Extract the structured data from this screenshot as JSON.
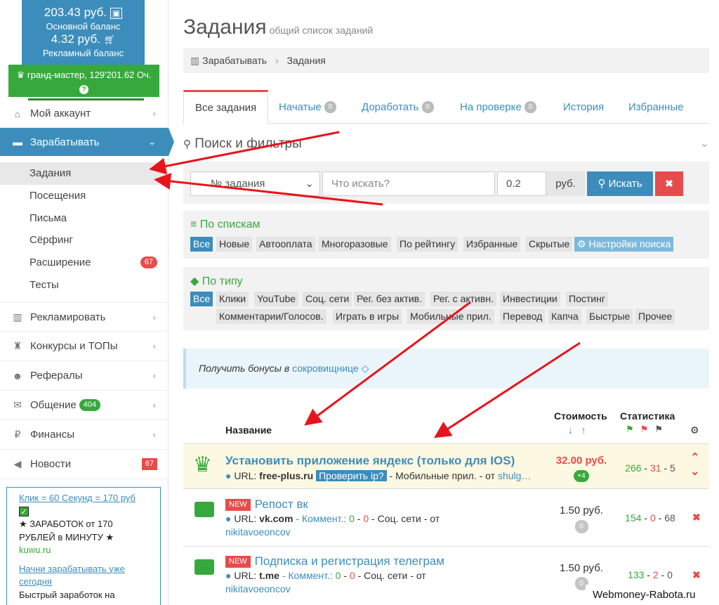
{
  "balance": {
    "main_amount": "203.43 руб.",
    "main_label": "Основной баланс",
    "ad_amount": "4.32 руб.",
    "ad_label": "Рекламный баланс"
  },
  "rank": {
    "text": "гранд-мастер, 129'201.62 Оч.",
    "help": "?"
  },
  "sidebar": {
    "my_account": "Мой аккаунт",
    "earn": "Зарабатывать",
    "sub_items": [
      "Задания",
      "Посещения",
      "Письма",
      "Сёрфинг",
      "Расширение",
      "Тесты"
    ],
    "ext_badge": "67",
    "advertise": "Рекламировать",
    "contests": "Конкурсы и ТОПы",
    "referrals": "Рефералы",
    "chat": "Общение",
    "chat_badge": "404",
    "finance": "Финансы",
    "news": "Новости",
    "news_badge": "67"
  },
  "ad": {
    "line1": "Клик = 60 Секунд = 170 руб",
    "check": "✓",
    "line2": "★ ЗАРАБОТОК от 170 РУБЛЕЙ в МИНУТУ ★",
    "line3": "kuwu.ru",
    "line4": "Начни зарабатывать уже сегодня",
    "line5": "Быстрый заработок на"
  },
  "page": {
    "title": "Задания",
    "subtitle": "общий список заданий"
  },
  "breadcrumb": {
    "root": "Зарабатывать",
    "sep": "›",
    "current": "Задания"
  },
  "tabs": [
    {
      "label": "Все задания"
    },
    {
      "label": "Начатые",
      "count": "0"
    },
    {
      "label": "Доработать",
      "count": "0"
    },
    {
      "label": "На проверке",
      "count": "0"
    },
    {
      "label": "История"
    },
    {
      "label": "Избранные"
    }
  ],
  "filters": {
    "title": "Поиск и фильтры",
    "select_value": "№ задания",
    "search_placeholder": "Что искать?",
    "price_value": "0.2",
    "currency": "руб.",
    "search_button": "Искать",
    "clear": "✖"
  },
  "lists": {
    "title": "По спискам",
    "items": [
      "Все",
      "Новые",
      "Автооплата",
      "Многоразовые",
      "По рейтингу",
      "Избранные",
      "Скрытые"
    ],
    "settings": "Настройки поиска"
  },
  "types": {
    "title": "По типу",
    "row1": [
      "Все",
      "Клики",
      "YouTube",
      "Соц. сети",
      "Рег. без актив.",
      "Рег. с активн.",
      "Инвестиции",
      "Постинг"
    ],
    "row2": [
      "Комментарии/Голосов.",
      "Играть в игры",
      "Мобильные прил.",
      "Перевод",
      "Капча",
      "Быстрые",
      "Прочее"
    ]
  },
  "bonus": {
    "text": "Получить бонусы в",
    "link": "сокровищнице"
  },
  "table": {
    "col_name": "Название",
    "col_price": "Стоимость",
    "col_stats": "Статистика"
  },
  "tasks": [
    {
      "name": "Установить приложение яндекс (только для IOS)",
      "url_label": "URL:",
      "url": "free-plus.ru",
      "check": "Проверить ip?",
      "category": "- Мобильные прил. - от",
      "author": "shulg…",
      "price": "32.00 руб.",
      "bonus": "+4",
      "stat_ok": "266",
      "stat_bad": "31",
      "stat_wait": "5"
    },
    {
      "badge": "NEW",
      "name": "Репост вк",
      "url_label": "URL:",
      "url": "vk.com",
      "comments": "- Коммент.:",
      "c_ok": "0",
      "c_bad": "0",
      "category": "- Соц. сети - от",
      "author": "nikitavoeoncov",
      "price": "1.50 руб.",
      "pill": "0",
      "stat_ok": "154",
      "stat_bad": "0",
      "stat_wait": "68"
    },
    {
      "badge": "NEW",
      "name": "Подписка и регистрация телеграм",
      "url_label": "URL:",
      "url": "t.me",
      "comments": "- Коммент.:",
      "c_ok": "0",
      "c_bad": "0",
      "category": "- Соц. сети - от",
      "author": "nikitavoeoncov",
      "price": "1.50 руб.",
      "pill": "0",
      "stat_ok": "133",
      "stat_bad": "2",
      "stat_wait": "0"
    }
  ],
  "watermark": "Webmoney-Rabota.ru",
  "colors": {
    "primary": "#3c8dbc",
    "success": "#37a93c",
    "danger": "#e74c4c",
    "annotation": "#e8141b"
  }
}
